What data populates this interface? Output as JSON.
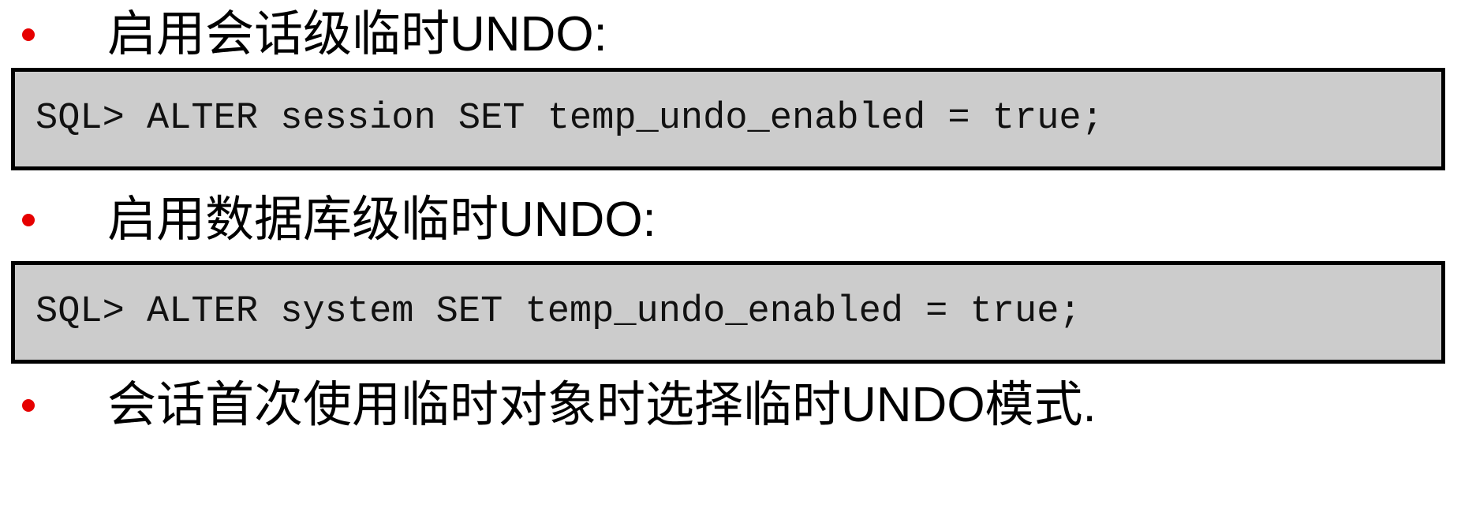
{
  "bullets": [
    {
      "text": "启用会话级临时UNDO:"
    },
    {
      "text": "启用数据库级临时UNDO:"
    },
    {
      "text": "会话首次使用临时对象时选择临时UNDO模式."
    }
  ],
  "code_blocks": [
    {
      "code": "SQL> ALTER session SET temp_undo_enabled = true;"
    },
    {
      "code": "SQL> ALTER system SET temp_undo_enabled = true;"
    }
  ],
  "colors": {
    "bullet": "#e60000",
    "code_background": "#cccccc",
    "code_border": "#000000"
  }
}
